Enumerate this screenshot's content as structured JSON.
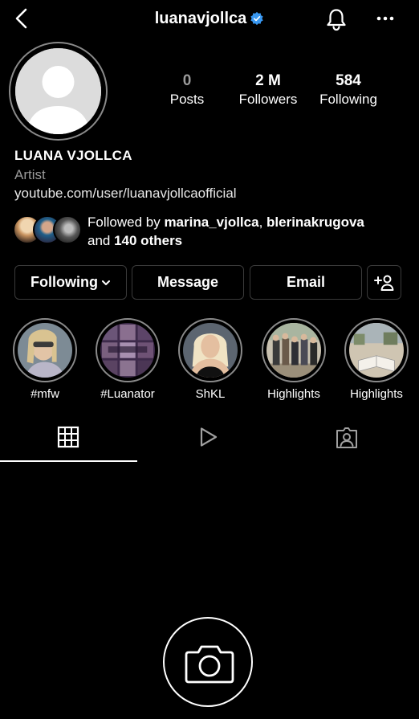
{
  "header": {
    "username": "luanavjollca",
    "icons": [
      "back-arrow-icon",
      "verified-badge-icon",
      "bell-icon",
      "more-icon"
    ]
  },
  "stats": {
    "posts": {
      "value": "0",
      "label": "Posts"
    },
    "followers": {
      "value": "2 M",
      "label": "Followers"
    },
    "following": {
      "value": "584",
      "label": "Following"
    }
  },
  "bio": {
    "name": "LUANA VJOLLCA",
    "category": "Artist",
    "link": "youtube.com/user/luanavjollcaofficial"
  },
  "followed_by": {
    "prefix": "Followed by ",
    "user1": "marina_vjollca",
    "separator": ", ",
    "user2": "blerinakrugova",
    "mid": "and ",
    "others": "140 others"
  },
  "actions": {
    "following": "Following",
    "message": "Message",
    "email": "Email"
  },
  "highlights": [
    {
      "label": "#mfw"
    },
    {
      "label": "#Luanator"
    },
    {
      "label": "ShKL"
    },
    {
      "label": "Highlights"
    },
    {
      "label": "Highlights"
    }
  ],
  "tabs": [
    "grid-icon",
    "reels-icon",
    "tagged-icon"
  ],
  "colors": {
    "verified": "#3897f0",
    "secondary_text": "#9a9a9a",
    "button_border": "#3a3a3a"
  }
}
